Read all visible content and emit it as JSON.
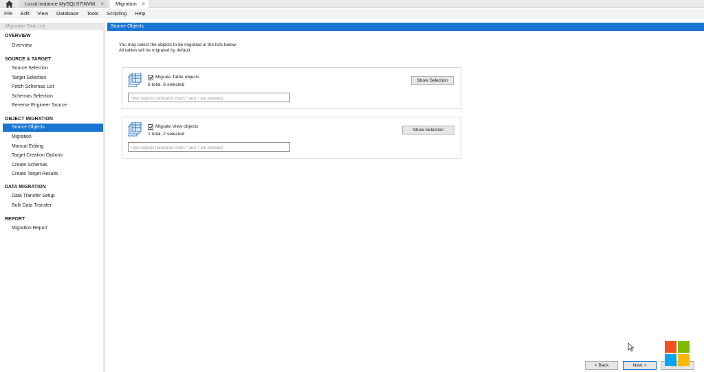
{
  "tabs": [
    {
      "label": "Local instance MySQL57INVM",
      "close": "×"
    },
    {
      "label": "Migration",
      "close": "×"
    }
  ],
  "menu": [
    "File",
    "Edit",
    "View",
    "Database",
    "Tools",
    "Scripting",
    "Help"
  ],
  "sidebar": {
    "title": "Migration Task List",
    "sections": [
      {
        "label": "OVERVIEW",
        "items": [
          "Overview"
        ]
      },
      {
        "label": "SOURCE & TARGET",
        "items": [
          "Source Selection",
          "Target Selection",
          "Fetch Schemas List",
          "Schemas Selection",
          "Reverse Engineer Source"
        ]
      },
      {
        "label": "OBJECT MIGRATION",
        "items": [
          "Source Objects",
          "Migration",
          "Manual Editing",
          "Target Creation Options",
          "Create Schemas",
          "Create Target Results"
        ]
      },
      {
        "label": "DATA MIGRATION",
        "items": [
          "Data Transfer Setup",
          "Bulk Data Transfer"
        ]
      },
      {
        "label": "REPORT",
        "items": [
          "Migration Report"
        ]
      }
    ],
    "active": "Source Objects"
  },
  "main": {
    "header": "Source Objects",
    "intro_line1": "You may select the objects to be migrated in the lists below.",
    "intro_line2": "All tables will be migrated by default.",
    "groups": [
      {
        "label": "Migrate Table objects",
        "count": "6 total, 6 selected",
        "checked": true,
        "filter_placeholder": "Filter objects (wildcards chars * and ? are allowed)",
        "button": "Show Selection"
      },
      {
        "label": "Migrate View objects",
        "count": "2 total, 2 selected",
        "checked": true,
        "filter_placeholder": "Filter objects (wildcards chars * and ? are allowed)",
        "button": "Show Selection"
      }
    ]
  },
  "footer": {
    "back": "< Back",
    "next": "Next >",
    "cancel": "Cancel"
  },
  "colors": {
    "accent": "#1975d2",
    "win_red": "#f25022",
    "win_green": "#7fba00",
    "win_blue": "#00a4ef",
    "win_yellow": "#ffb900"
  }
}
